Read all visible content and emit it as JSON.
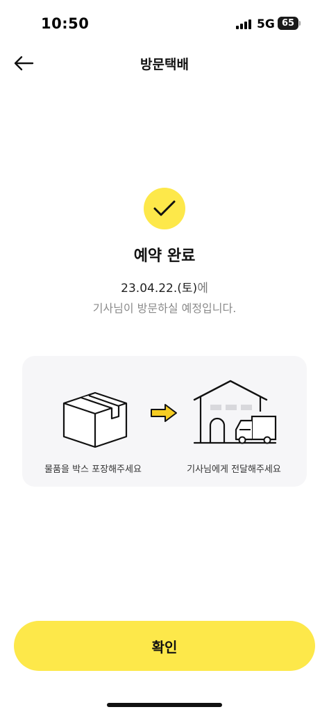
{
  "status_bar": {
    "time": "10:50",
    "network": "5G",
    "battery": "65",
    "battery_level": 0.65,
    "signal_icon": "cellular-signal-icon",
    "battery_icon": "battery-icon"
  },
  "header": {
    "title": "방문택배",
    "back_icon": "arrow-left-icon"
  },
  "result": {
    "icon": "checkmark-icon",
    "title": "예약 완료",
    "date": "23.04.22.(토)",
    "date_suffix": "에",
    "message": "기사님이 방문하실 예정입니다."
  },
  "steps": [
    {
      "icon": "package-box-icon",
      "label": "물품을 박스 포장해주세요"
    },
    {
      "icon": "delivery-house-icon",
      "label": "기사님에게 전달해주세요"
    }
  ],
  "steps_arrow_icon": "arrow-right-icon",
  "confirm_label": "확인",
  "colors": {
    "accent_yellow": "#fde84a",
    "card_background": "#f6f6f8",
    "muted_text": "#8a8a8a"
  }
}
